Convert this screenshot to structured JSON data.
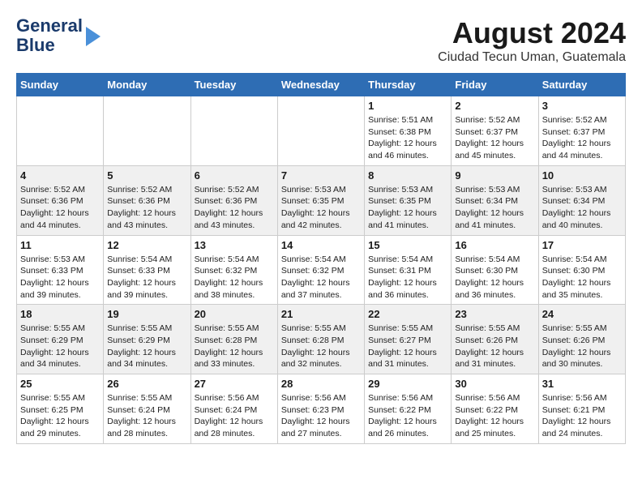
{
  "header": {
    "logo_line1": "General",
    "logo_line2": "Blue",
    "month_title": "August 2024",
    "location": "Ciudad Tecun Uman, Guatemala"
  },
  "weekdays": [
    "Sunday",
    "Monday",
    "Tuesday",
    "Wednesday",
    "Thursday",
    "Friday",
    "Saturday"
  ],
  "weeks": [
    [
      {
        "day": "",
        "info": ""
      },
      {
        "day": "",
        "info": ""
      },
      {
        "day": "",
        "info": ""
      },
      {
        "day": "",
        "info": ""
      },
      {
        "day": "1",
        "info": "Sunrise: 5:51 AM\nSunset: 6:38 PM\nDaylight: 12 hours\nand 46 minutes."
      },
      {
        "day": "2",
        "info": "Sunrise: 5:52 AM\nSunset: 6:37 PM\nDaylight: 12 hours\nand 45 minutes."
      },
      {
        "day": "3",
        "info": "Sunrise: 5:52 AM\nSunset: 6:37 PM\nDaylight: 12 hours\nand 44 minutes."
      }
    ],
    [
      {
        "day": "4",
        "info": "Sunrise: 5:52 AM\nSunset: 6:36 PM\nDaylight: 12 hours\nand 44 minutes."
      },
      {
        "day": "5",
        "info": "Sunrise: 5:52 AM\nSunset: 6:36 PM\nDaylight: 12 hours\nand 43 minutes."
      },
      {
        "day": "6",
        "info": "Sunrise: 5:52 AM\nSunset: 6:36 PM\nDaylight: 12 hours\nand 43 minutes."
      },
      {
        "day": "7",
        "info": "Sunrise: 5:53 AM\nSunset: 6:35 PM\nDaylight: 12 hours\nand 42 minutes."
      },
      {
        "day": "8",
        "info": "Sunrise: 5:53 AM\nSunset: 6:35 PM\nDaylight: 12 hours\nand 41 minutes."
      },
      {
        "day": "9",
        "info": "Sunrise: 5:53 AM\nSunset: 6:34 PM\nDaylight: 12 hours\nand 41 minutes."
      },
      {
        "day": "10",
        "info": "Sunrise: 5:53 AM\nSunset: 6:34 PM\nDaylight: 12 hours\nand 40 minutes."
      }
    ],
    [
      {
        "day": "11",
        "info": "Sunrise: 5:53 AM\nSunset: 6:33 PM\nDaylight: 12 hours\nand 39 minutes."
      },
      {
        "day": "12",
        "info": "Sunrise: 5:54 AM\nSunset: 6:33 PM\nDaylight: 12 hours\nand 39 minutes."
      },
      {
        "day": "13",
        "info": "Sunrise: 5:54 AM\nSunset: 6:32 PM\nDaylight: 12 hours\nand 38 minutes."
      },
      {
        "day": "14",
        "info": "Sunrise: 5:54 AM\nSunset: 6:32 PM\nDaylight: 12 hours\nand 37 minutes."
      },
      {
        "day": "15",
        "info": "Sunrise: 5:54 AM\nSunset: 6:31 PM\nDaylight: 12 hours\nand 36 minutes."
      },
      {
        "day": "16",
        "info": "Sunrise: 5:54 AM\nSunset: 6:30 PM\nDaylight: 12 hours\nand 36 minutes."
      },
      {
        "day": "17",
        "info": "Sunrise: 5:54 AM\nSunset: 6:30 PM\nDaylight: 12 hours\nand 35 minutes."
      }
    ],
    [
      {
        "day": "18",
        "info": "Sunrise: 5:55 AM\nSunset: 6:29 PM\nDaylight: 12 hours\nand 34 minutes."
      },
      {
        "day": "19",
        "info": "Sunrise: 5:55 AM\nSunset: 6:29 PM\nDaylight: 12 hours\nand 34 minutes."
      },
      {
        "day": "20",
        "info": "Sunrise: 5:55 AM\nSunset: 6:28 PM\nDaylight: 12 hours\nand 33 minutes."
      },
      {
        "day": "21",
        "info": "Sunrise: 5:55 AM\nSunset: 6:28 PM\nDaylight: 12 hours\nand 32 minutes."
      },
      {
        "day": "22",
        "info": "Sunrise: 5:55 AM\nSunset: 6:27 PM\nDaylight: 12 hours\nand 31 minutes."
      },
      {
        "day": "23",
        "info": "Sunrise: 5:55 AM\nSunset: 6:26 PM\nDaylight: 12 hours\nand 31 minutes."
      },
      {
        "day": "24",
        "info": "Sunrise: 5:55 AM\nSunset: 6:26 PM\nDaylight: 12 hours\nand 30 minutes."
      }
    ],
    [
      {
        "day": "25",
        "info": "Sunrise: 5:55 AM\nSunset: 6:25 PM\nDaylight: 12 hours\nand 29 minutes."
      },
      {
        "day": "26",
        "info": "Sunrise: 5:55 AM\nSunset: 6:24 PM\nDaylight: 12 hours\nand 28 minutes."
      },
      {
        "day": "27",
        "info": "Sunrise: 5:56 AM\nSunset: 6:24 PM\nDaylight: 12 hours\nand 28 minutes."
      },
      {
        "day": "28",
        "info": "Sunrise: 5:56 AM\nSunset: 6:23 PM\nDaylight: 12 hours\nand 27 minutes."
      },
      {
        "day": "29",
        "info": "Sunrise: 5:56 AM\nSunset: 6:22 PM\nDaylight: 12 hours\nand 26 minutes."
      },
      {
        "day": "30",
        "info": "Sunrise: 5:56 AM\nSunset: 6:22 PM\nDaylight: 12 hours\nand 25 minutes."
      },
      {
        "day": "31",
        "info": "Sunrise: 5:56 AM\nSunset: 6:21 PM\nDaylight: 12 hours\nand 24 minutes."
      }
    ]
  ]
}
